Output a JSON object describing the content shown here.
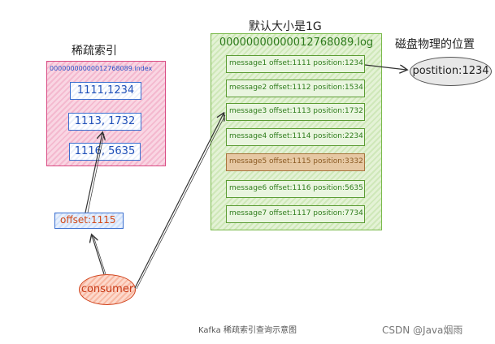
{
  "index_section": {
    "heading": "稀疏索引",
    "file_name": "00000000000012768089.index",
    "entries": [
      "1111,1234",
      "1113, 1732",
      "1116, 5635"
    ]
  },
  "log_section": {
    "heading": "默认大小是1G",
    "file_name": "00000000000012768089.log",
    "messages": [
      "message1 offset:1111 position:1234",
      "message2 offset:1112 position:1534",
      "message3 offset:1113 position:1732",
      "message4 offset:1114 position:2234",
      "message5 offset:1115 position:3332",
      "message6 offset:1116 position:5635",
      "message7 offset:1117 position:7734"
    ],
    "highlighted_index": 4
  },
  "disk_section": {
    "heading": "磁盘物理的位置",
    "position_label": "postition:1234"
  },
  "offset_box": {
    "label": "offset:1115"
  },
  "consumer": {
    "label": "consumer"
  },
  "caption": "Kafka 稀疏索引查询示意图",
  "watermark": "CSDN @Java烟雨",
  "colors": {
    "index_accent": "#d94c84",
    "log_accent": "#79b94a",
    "highlight": "#e6c8a3",
    "consumer_accent": "#d0421b"
  }
}
